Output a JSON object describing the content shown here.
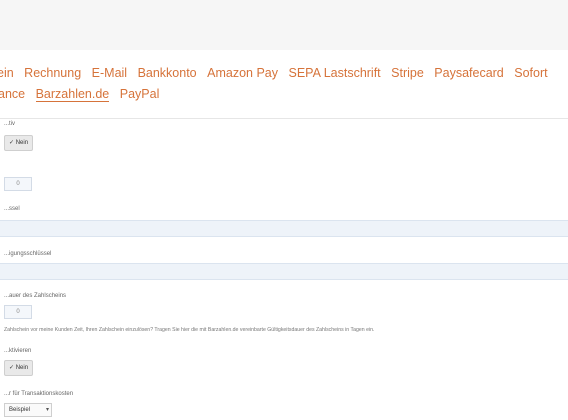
{
  "tabs": {
    "row1": [
      {
        "label": "ein",
        "active": false
      },
      {
        "label": "Rechnung",
        "active": false
      },
      {
        "label": "E-Mail",
        "active": false
      },
      {
        "label": "Bankkonto",
        "active": false
      },
      {
        "label": "Amazon Pay",
        "active": false
      },
      {
        "label": "SEPA Lastschrift",
        "active": false
      },
      {
        "label": "Stripe",
        "active": false
      },
      {
        "label": "Paysafecard",
        "active": false
      },
      {
        "label": "Sofort",
        "active": false
      }
    ],
    "row2": [
      {
        "label": "ance",
        "active": false
      },
      {
        "label": "Barzahlen.de",
        "active": true
      },
      {
        "label": "PayPal",
        "active": false
      }
    ]
  },
  "form": {
    "f1_label": "...tiv",
    "f1_button": "✓ Nein",
    "f2_value": "0",
    "f3_label": "...ssel",
    "f4_label": "...igungsschlüssel",
    "f5_label": "...auer des Zahlscheins",
    "f5_value": "0",
    "f5_hint": "Zahlschein vor meine Kunden Zeit, Ihren Zahlschein einzulösen? Tragen Sie hier die mit Barzahlen.de vereinbarte Gültigkeitsdauer des Zahlscheins in Tagen ein.",
    "f6_label": "...ktivieren",
    "f6_button": "✓ Nein",
    "f7_label": "...r für Transaktionskosten",
    "f7_select": "Beispiel"
  }
}
